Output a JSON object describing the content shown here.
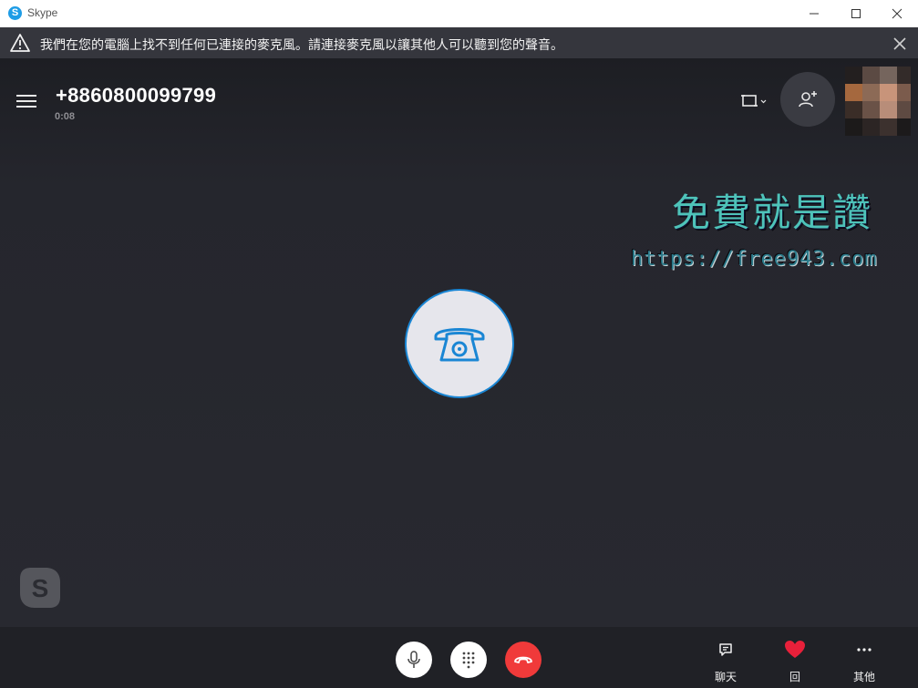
{
  "window": {
    "title": "Skype",
    "logo_letter": "S"
  },
  "warning": {
    "text": "我們在您的電腦上找不到任何已連接的麥克風。請連接麥克風以讓其他人可以聽到您的聲音。"
  },
  "call": {
    "phone_number": "+8860800099799",
    "duration": "0:08"
  },
  "watermark": {
    "title": "免費就是讚",
    "url": "https://free943.com"
  },
  "controls": {
    "chat_label": "聊天",
    "react_label": "回",
    "more_label": "其他"
  },
  "brand": {
    "logo_letter": "S"
  },
  "colors": {
    "accent": "#1a86d4",
    "hangup": "#f03a3a",
    "heart": "#e8203a",
    "skype_blue": "#1e9ce6"
  }
}
